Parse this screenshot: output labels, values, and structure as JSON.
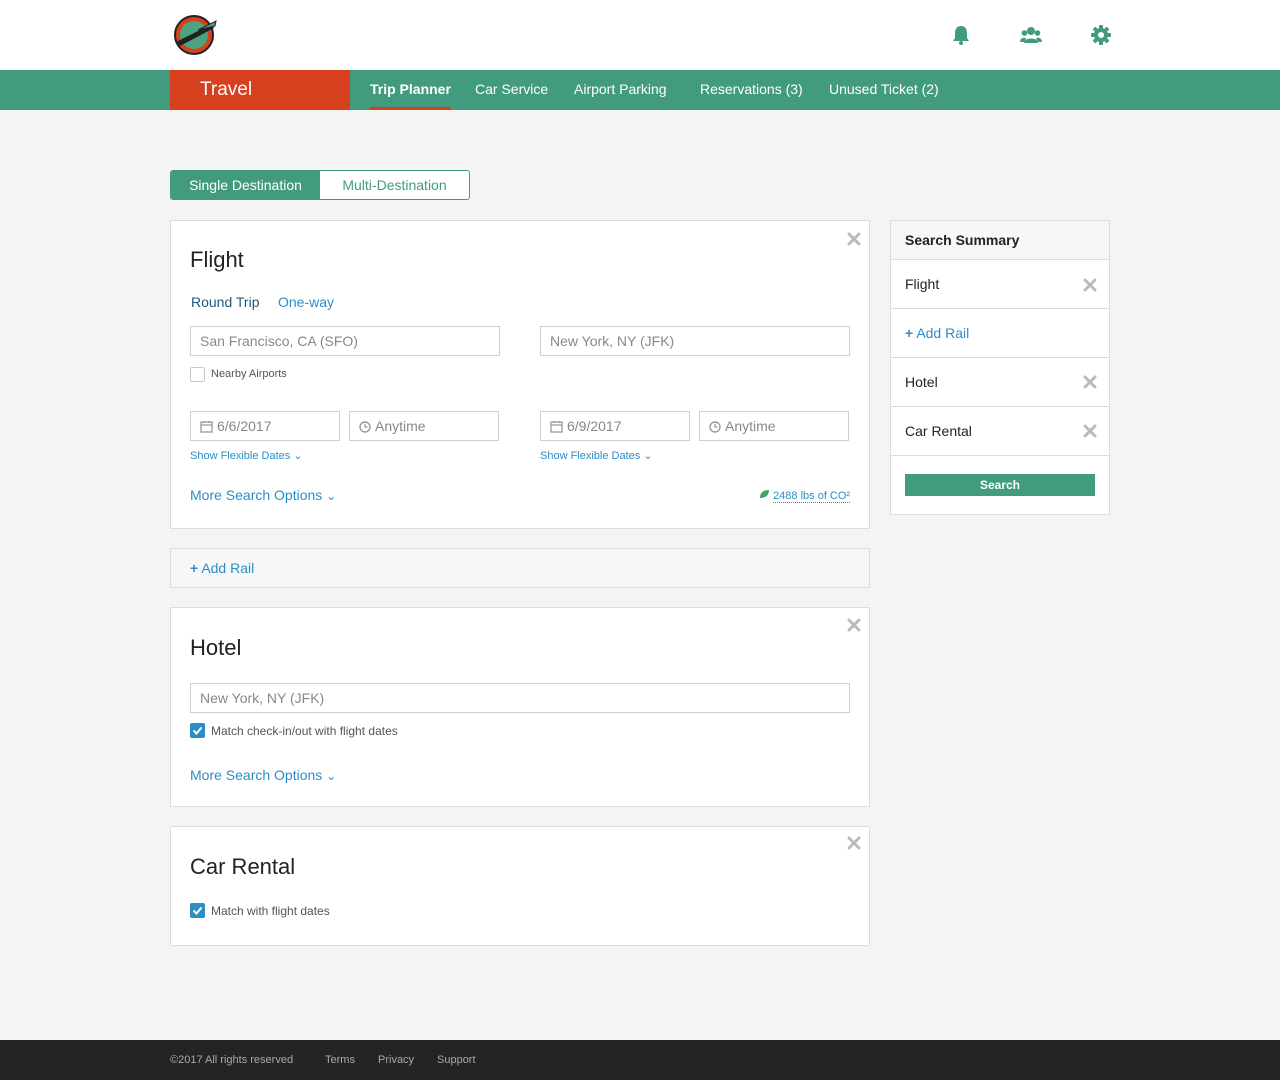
{
  "header": {
    "logo_icon": "planet-express-logo",
    "icons": [
      "bell-icon",
      "users-icon",
      "gear-icon"
    ]
  },
  "nav": {
    "section": "Travel",
    "items": [
      {
        "label": "Trip Planner",
        "active": true
      },
      {
        "label": "Car Service"
      },
      {
        "label": "Airport Parking"
      },
      {
        "label": "Reservations (3)"
      },
      {
        "label": "Unused Ticket (2)"
      }
    ]
  },
  "destination_toggle": {
    "single": "Single Destination",
    "multi": "Multi-Destination",
    "selected": "single"
  },
  "flight": {
    "title": "Flight",
    "trip_types": [
      "Round Trip",
      "One-way"
    ],
    "origin": "San Francisco, CA (SFO)",
    "destination": "New York, NY (JFK)",
    "nearby_airports": "Nearby Airports",
    "depart_date": "6/6/2017",
    "depart_time": "Anytime",
    "return_date": "6/9/2017",
    "return_time": "Anytime",
    "flexible_dates": "Show Flexible Dates",
    "more_options": "More Search Options",
    "co2": "2488 lbs of CO²"
  },
  "add_rail": "Add Rail",
  "hotel": {
    "title": "Hotel",
    "location": "New York, NY (JFK)",
    "match_dates": "Match check-in/out with flight dates",
    "more_options": "More Search Options"
  },
  "car_rental": {
    "title": "Car Rental",
    "match_dates": "Match with flight dates"
  },
  "summary": {
    "title": "Search Summary",
    "flight": "Flight",
    "add_rail": "Add Rail",
    "hotel": "Hotel",
    "car_rental": "Car Rental",
    "search": "Search"
  },
  "footer": {
    "copyright": "©2017 All rights reserved",
    "links": [
      "Terms",
      "Privacy",
      "Support"
    ]
  },
  "colors": {
    "brand_green": "#439b7f",
    "accent_red": "#d6401f",
    "link_blue": "#2a8fc7"
  }
}
